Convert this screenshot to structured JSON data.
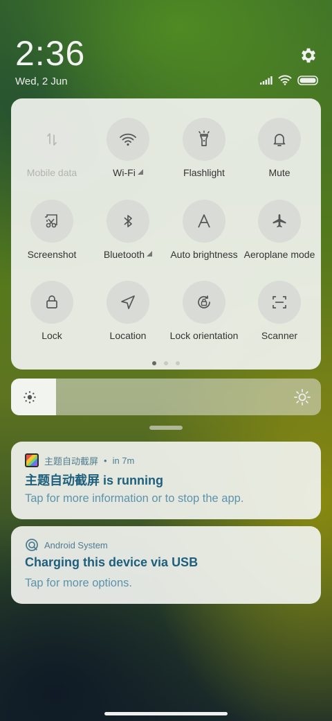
{
  "status": {
    "time": "2:36",
    "date": "Wed, 2 Jun"
  },
  "quick_settings": {
    "tiles": [
      {
        "label": "Mobile data",
        "icon": "mobile-data-icon",
        "enabled": false
      },
      {
        "label": "Wi-Fi",
        "icon": "wifi-icon",
        "expandable": true
      },
      {
        "label": "Flashlight",
        "icon": "flashlight-icon"
      },
      {
        "label": "Mute",
        "icon": "bell-icon"
      },
      {
        "label": "Screenshot",
        "icon": "scissors-icon"
      },
      {
        "label": "Bluetooth",
        "icon": "bluetooth-icon",
        "expandable": true
      },
      {
        "label": "Auto brightness",
        "icon": "auto-brightness-icon"
      },
      {
        "label": "Aeroplane mode",
        "icon": "airplane-icon"
      },
      {
        "label": "Lock",
        "icon": "lock-icon"
      },
      {
        "label": "Location",
        "icon": "location-icon"
      },
      {
        "label": "Lock orientation",
        "icon": "rotation-lock-icon"
      },
      {
        "label": "Scanner",
        "icon": "scanner-icon"
      }
    ],
    "pages": 3,
    "current_page": 1
  },
  "brightness": {
    "level": 0.145
  },
  "notifications": [
    {
      "app": "主题自动截屏",
      "time": "in 7m",
      "title": "主题自动截屏 is running",
      "text": "Tap for more information or to stop the app.",
      "icon": "app-theme-icon"
    },
    {
      "app": "Android System",
      "time": "",
      "title": "Charging this device via USB",
      "text": "Tap for more options.",
      "icon": "android-system-icon"
    }
  ],
  "colors": {
    "panel": "#f0f2ee",
    "tile_circle": "#d8dbd6",
    "notif_title": "#1d5f7c",
    "notif_text": "#5d93aa"
  }
}
